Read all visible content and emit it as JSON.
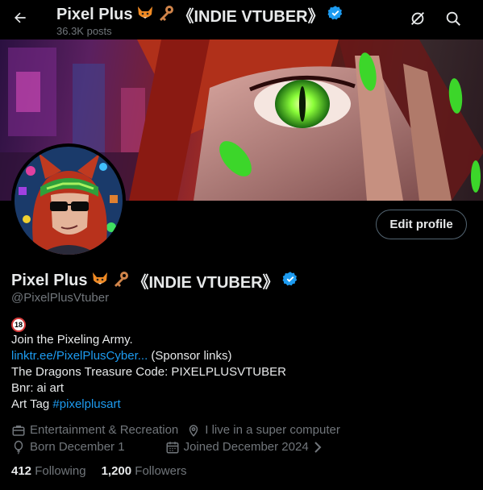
{
  "header": {
    "title": "Pixel Plus",
    "title_suffix": "《INDIE VTUBER》",
    "posts_count": "36.3K posts"
  },
  "profile": {
    "display_name": "Pixel Plus",
    "name_suffix": "《INDIE VTUBER》",
    "handle": "@PixelPlusVtuber",
    "edit_button": "Edit profile",
    "verified_color": "#1d9bf0"
  },
  "bio": {
    "age_badge": "18",
    "line1": "Join the Pixeling Army.",
    "link_text": "linktr.ee/PixelPlusCyber...",
    "link_suffix": " (Sponsor links)",
    "line3": "The Dragons Treasure Code: PIXELPLUSVTUBER",
    "line4": "Bnr: ai art",
    "art_tag_prefix": "Art Tag ",
    "art_tag": "#pixelplusart"
  },
  "meta": {
    "category": "Entertainment & Recreation",
    "location": "I live in a super computer",
    "born": "Born December 1",
    "joined": "Joined December 2024"
  },
  "stats": {
    "following_count": "412",
    "following_label": "Following",
    "followers_count": "1,200",
    "followers_label": "Followers"
  },
  "colors": {
    "background": "#000000",
    "text": "#e7e9ea",
    "muted": "#71767b",
    "accent": "#1d9bf0"
  },
  "icons": [
    "back-arrow-icon",
    "fox-emoji-icon",
    "key-emoji-icon",
    "verified-badge-icon",
    "unpin-icon",
    "search-icon",
    "briefcase-icon",
    "location-pin-icon",
    "balloon-icon",
    "calendar-icon",
    "chevron-right-icon"
  ]
}
